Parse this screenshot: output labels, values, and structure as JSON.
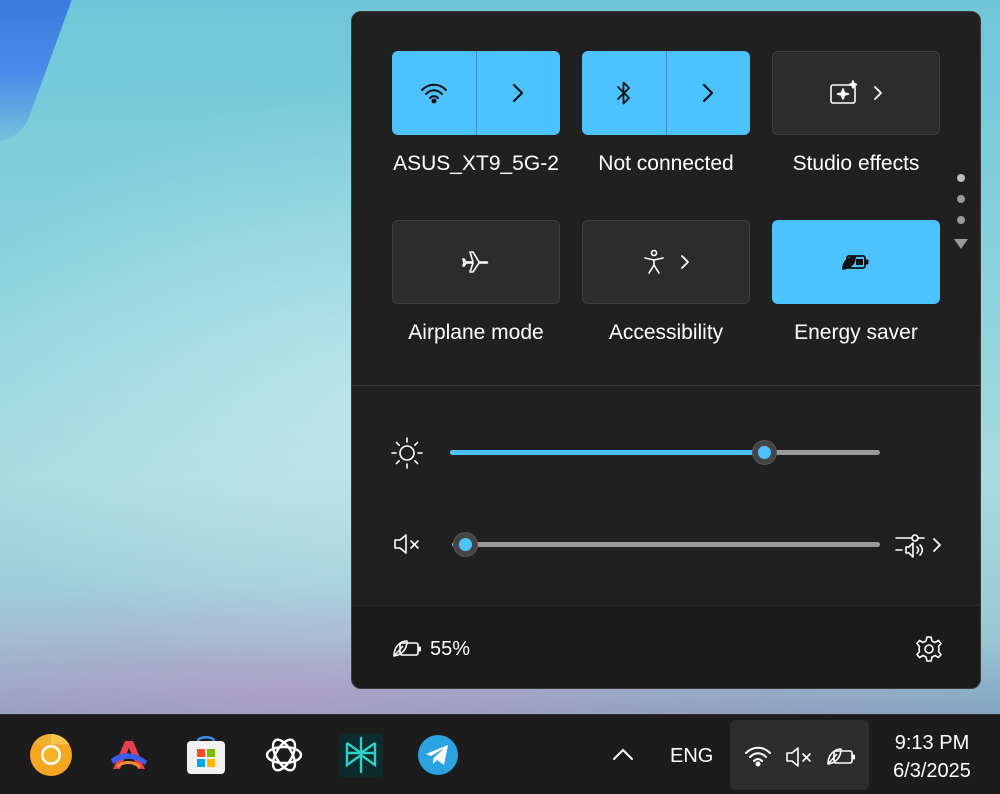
{
  "quick_settings": {
    "tiles": [
      {
        "label": "ASUS_XT9_5G-2",
        "icon": "wifi-icon",
        "state": "on"
      },
      {
        "label": "Not connected",
        "icon": "bluetooth-icon",
        "state": "on"
      },
      {
        "label": "Studio effects",
        "icon": "studio-effects-icon",
        "state": "off"
      },
      {
        "label": "Airplane mode",
        "icon": "airplane-icon",
        "state": "off"
      },
      {
        "label": "Accessibility",
        "icon": "accessibility-icon",
        "state": "off"
      },
      {
        "label": "Energy saver",
        "icon": "energy-saver-icon",
        "state": "on"
      }
    ],
    "brightness": {
      "icon": "brightness-icon",
      "level": 0.73
    },
    "volume": {
      "icon": "volume-muted-icon",
      "level": 0.03,
      "muted": true
    },
    "battery": {
      "percent": "55%",
      "icon": "battery-leaf-icon"
    },
    "settings_icon": "gear-icon",
    "accent": "#4cc2ff"
  },
  "taskbar": {
    "apps": [
      "chrome-canary-icon",
      "arc-browser-icon",
      "microsoft-store-icon",
      "chatgpt-icon",
      "perplexity-icon",
      "telegram-icon"
    ],
    "tray": {
      "language": "ENG"
    },
    "clock": {
      "time": "9:13 PM",
      "date": "6/3/2025"
    }
  }
}
